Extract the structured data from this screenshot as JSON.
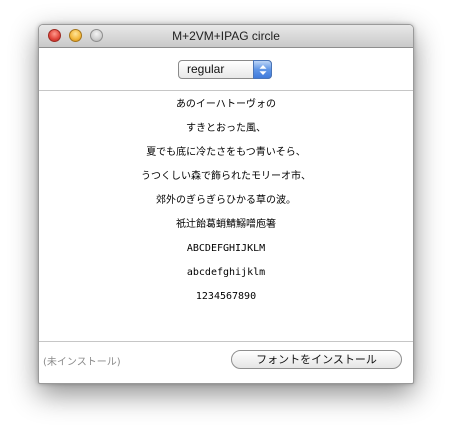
{
  "window": {
    "title": "M+2VM+IPAG circle"
  },
  "style_popup": {
    "selected": "regular"
  },
  "sample_lines": [
    "あのイーハトーヴォの",
    "すきとおった風、",
    "夏でも底に冷たさをもつ青いそら、",
    "うつくしい森で飾られたモリーオ市、",
    "郊外のぎらぎらひかる草の波。",
    "祇辻飴葛蛸鯖鰯噌庖箸",
    "ABCDEFGHIJKLM",
    "abcdefghijklm",
    "1234567890"
  ],
  "footer": {
    "status": "(未インストール)",
    "install_label": "フォントをインストール"
  }
}
